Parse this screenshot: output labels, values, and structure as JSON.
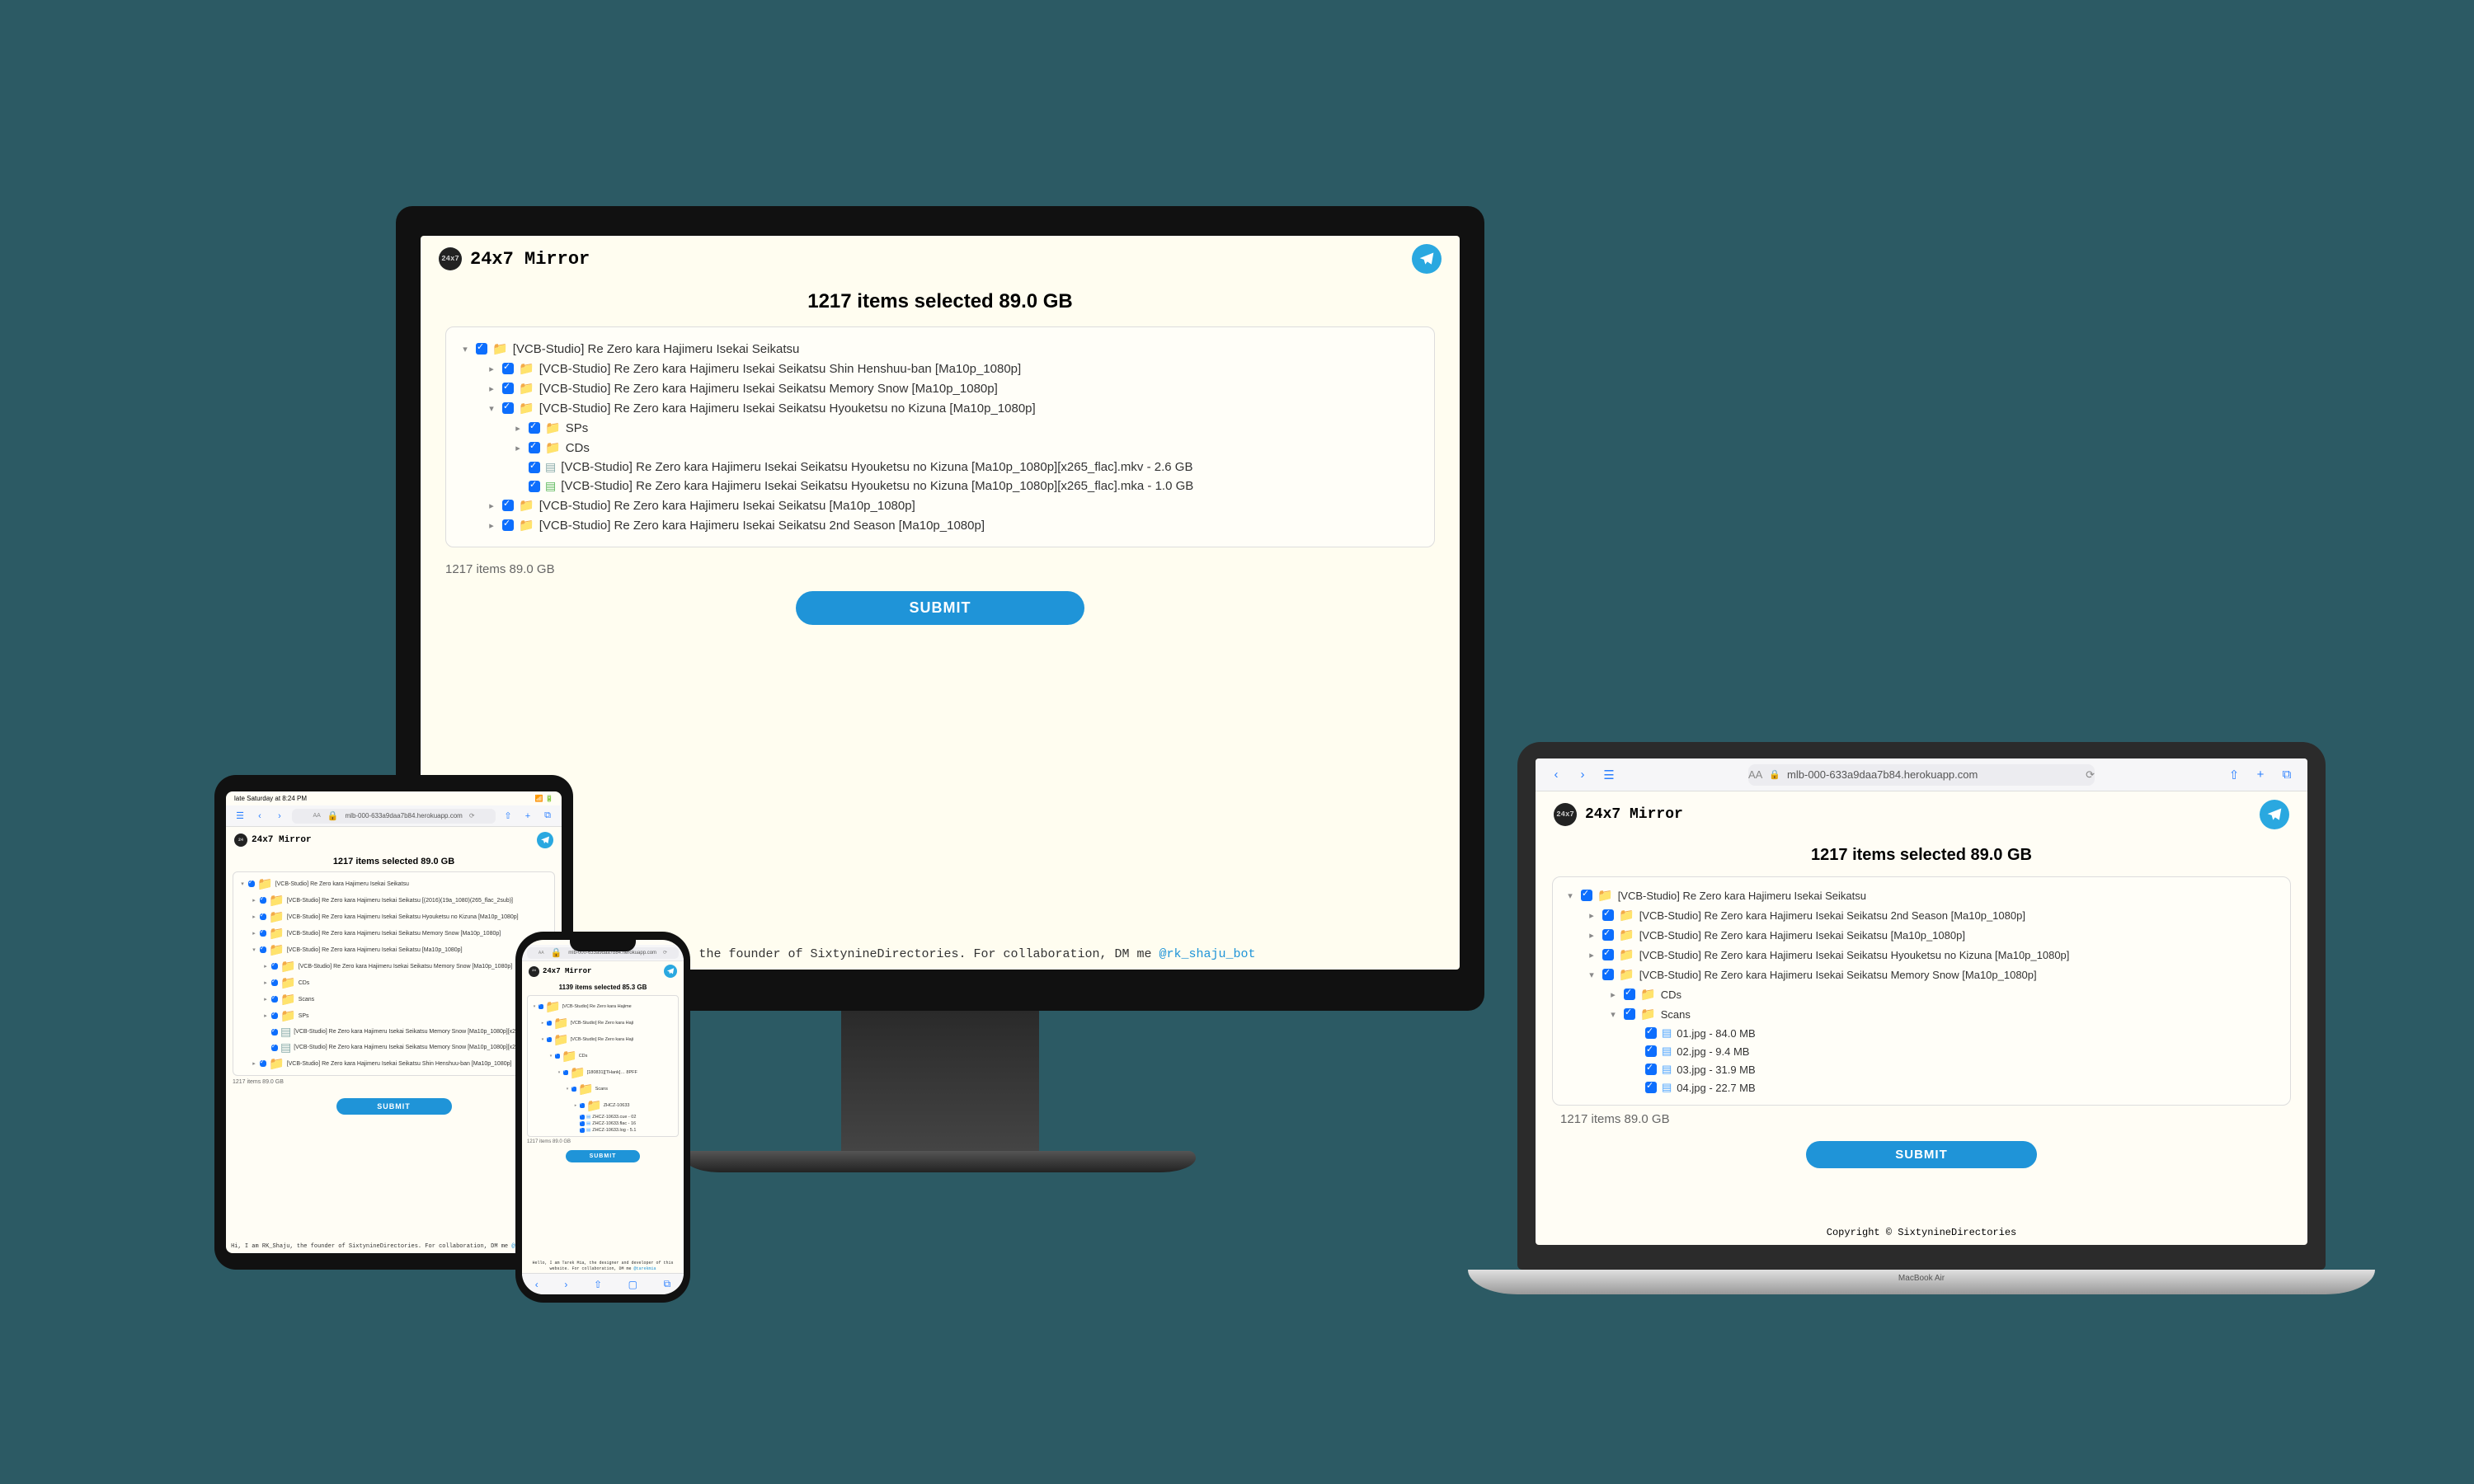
{
  "app_title": "24x7 Mirror",
  "telegram_icon": "telegram",
  "submit_label": "SUBMIT",
  "url_host": "mlb-000-633a9daa7b84.herokuapp.com",
  "laptop_brand": "MacBook Air",
  "copyright": "Copyright © SixtynineDirectories",
  "tablet_status_left": "late Saturday at 8:24 PM",
  "desktop": {
    "items_bar": "1217 items selected 89.0 GB",
    "status_line": "1217 items 89.0 GB",
    "tree": [
      {
        "depth": 0,
        "arrow": "v",
        "type": "folder",
        "label": "[VCB-Studio] Re Zero kara Hajimeru Isekai Seikatsu"
      },
      {
        "depth": 1,
        "arrow": ">",
        "type": "folder",
        "label": "[VCB-Studio] Re Zero kara Hajimeru Isekai Seikatsu Shin Henshuu-ban [Ma10p_1080p]"
      },
      {
        "depth": 1,
        "arrow": ">",
        "type": "folder",
        "label": "[VCB-Studio] Re Zero kara Hajimeru Isekai Seikatsu Memory Snow [Ma10p_1080p]"
      },
      {
        "depth": 1,
        "arrow": "v",
        "type": "folder",
        "label": "[VCB-Studio] Re Zero kara Hajimeru Isekai Seikatsu Hyouketsu no Kizuna [Ma10p_1080p]"
      },
      {
        "depth": 2,
        "arrow": ">",
        "type": "folder",
        "label": "SPs"
      },
      {
        "depth": 2,
        "arrow": ">",
        "type": "folder",
        "label": "CDs"
      },
      {
        "depth": 2,
        "arrow": "",
        "type": "file-grey",
        "label": "[VCB-Studio] Re Zero kara Hajimeru Isekai Seikatsu Hyouketsu no Kizuna [Ma10p_1080p][x265_flac].mkv - 2.6 GB"
      },
      {
        "depth": 2,
        "arrow": "",
        "type": "file-green",
        "label": "[VCB-Studio] Re Zero kara Hajimeru Isekai Seikatsu Hyouketsu no Kizuna [Ma10p_1080p][x265_flac].mka - 1.0 GB"
      },
      {
        "depth": 1,
        "arrow": ">",
        "type": "folder",
        "label": "[VCB-Studio] Re Zero kara Hajimeru Isekai Seikatsu [Ma10p_1080p]"
      },
      {
        "depth": 1,
        "arrow": ">",
        "type": "folder",
        "label": "[VCB-Studio] Re Zero kara Hajimeru Isekai Seikatsu 2nd Season [Ma10p_1080p]"
      }
    ],
    "footer": {
      "pre": "RK_Shaju, the founder of SixtynineDirectories. For collaboration, DM me ",
      "link": "@rk_shaju_bot"
    }
  },
  "laptop": {
    "items_bar": "1217 items selected 89.0 GB",
    "status_line": "1217 items 89.0 GB",
    "tree": [
      {
        "depth": 0,
        "arrow": "v",
        "type": "folder",
        "label": "[VCB-Studio] Re Zero kara Hajimeru Isekai Seikatsu"
      },
      {
        "depth": 1,
        "arrow": ">",
        "type": "folder",
        "label": "[VCB-Studio] Re Zero kara Hajimeru Isekai Seikatsu 2nd Season [Ma10p_1080p]"
      },
      {
        "depth": 1,
        "arrow": ">",
        "type": "folder",
        "label": "[VCB-Studio] Re Zero kara Hajimeru Isekai Seikatsu [Ma10p_1080p]"
      },
      {
        "depth": 1,
        "arrow": ">",
        "type": "folder",
        "label": "[VCB-Studio] Re Zero kara Hajimeru Isekai Seikatsu Hyouketsu no Kizuna [Ma10p_1080p]"
      },
      {
        "depth": 1,
        "arrow": "v",
        "type": "folder",
        "label": "[VCB-Studio] Re Zero kara Hajimeru Isekai Seikatsu Memory Snow [Ma10p_1080p]"
      },
      {
        "depth": 2,
        "arrow": ">",
        "type": "folder",
        "label": "CDs"
      },
      {
        "depth": 2,
        "arrow": "v",
        "type": "folder",
        "label": "Scans"
      },
      {
        "depth": 3,
        "arrow": "",
        "type": "file-blue",
        "label": "01.jpg - 84.0 MB"
      },
      {
        "depth": 3,
        "arrow": "",
        "type": "file-blue",
        "label": "02.jpg - 9.4 MB"
      },
      {
        "depth": 3,
        "arrow": "",
        "type": "file-blue",
        "label": "03.jpg - 31.9 MB"
      },
      {
        "depth": 3,
        "arrow": "",
        "type": "file-blue",
        "label": "04.jpg - 22.7 MB"
      }
    ]
  },
  "tablet": {
    "items_bar": "1217 items selected 89.0 GB",
    "status_line": "1217 items 89.0 GB",
    "tree": [
      {
        "depth": 0,
        "arrow": "v",
        "type": "folder",
        "label": "[VCB-Studio] Re Zero kara Hajimeru Isekai Seikatsu"
      },
      {
        "depth": 1,
        "arrow": ">",
        "type": "folder",
        "label": "[VCB-Studio] Re Zero kara Hajimeru Isekai Seikatsu [(2016)(19a_1080)(265_flac_2sub)]"
      },
      {
        "depth": 1,
        "arrow": ">",
        "type": "folder",
        "label": "[VCB-Studio] Re Zero kara Hajimeru Isekai Seikatsu Hyouketsu no Kizuna [Ma10p_1080p]"
      },
      {
        "depth": 1,
        "arrow": ">",
        "type": "folder",
        "label": "[VCB-Studio] Re Zero kara Hajimeru Isekai Seikatsu Memory Snow [Ma10p_1080p]"
      },
      {
        "depth": 1,
        "arrow": "v",
        "type": "folder",
        "label": "[VCB-Studio] Re Zero kara Hajimeru Isekai Seikatsu [Ma10p_1080p]"
      },
      {
        "depth": 2,
        "arrow": ">",
        "type": "folder",
        "label": "[VCB-Studio] Re Zero kara Hajimeru Isekai Seikatsu Memory Snow [Ma10p_1080p]"
      },
      {
        "depth": 2,
        "arrow": ">",
        "type": "folder",
        "label": "CDs"
      },
      {
        "depth": 2,
        "arrow": ">",
        "type": "folder",
        "label": "Scans"
      },
      {
        "depth": 2,
        "arrow": ">",
        "type": "folder",
        "label": "SPs"
      },
      {
        "depth": 2,
        "arrow": "",
        "type": "file-grey",
        "label": "[VCB-Studio] Re Zero kara Hajimeru Isekai Seikatsu Memory Snow [Ma10p_1080p][x265]"
      },
      {
        "depth": 2,
        "arrow": "",
        "type": "file-grey",
        "label": "[VCB-Studio] Re Zero kara Hajimeru Isekai Seikatsu Memory Snow [Ma10p_1080p][x265]"
      },
      {
        "depth": 1,
        "arrow": ">",
        "type": "folder",
        "label": "[VCB-Studio] Re Zero kara Hajimeru Isekai Seikatsu Shin Henshuu-ban [Ma10p_1080p]"
      }
    ],
    "footer": {
      "pre": "Hi, I am RK_Shaju, the founder of SixtynineDirectories. For collaboration, DM me ",
      "link": "@rk_shaju_bot"
    }
  },
  "phone": {
    "items_bar": "1139 items selected 85.3 GB",
    "status_line": "1217 items 89.0 GB",
    "tree": [
      {
        "depth": 0,
        "arrow": "v",
        "type": "folder",
        "label": "[VCB-Studio] Re Zero kara Hajime"
      },
      {
        "depth": 1,
        "arrow": ">",
        "type": "folder",
        "label": "[VCB-Studio] Re Zero kara Haji"
      },
      {
        "depth": 1,
        "arrow": "v",
        "type": "folder",
        "label": "[VCB-Studio] Re Zero kara Haji"
      },
      {
        "depth": 2,
        "arrow": "v",
        "type": "folder",
        "label": "CDs"
      },
      {
        "depth": 3,
        "arrow": "v",
        "type": "folder",
        "label": "[180831][THank]… 8PFF"
      },
      {
        "depth": 4,
        "arrow": "v",
        "type": "folder",
        "label": "Scans"
      },
      {
        "depth": 5,
        "arrow": ">",
        "type": "folder",
        "label": "ZHCZ-10633"
      },
      {
        "depth": 5,
        "arrow": "",
        "type": "file-blue",
        "label": "ZHCZ-10633.cue - 02"
      },
      {
        "depth": 5,
        "arrow": "",
        "type": "file-blue",
        "label": "ZHCZ-10633.flac - 16"
      },
      {
        "depth": 5,
        "arrow": "",
        "type": "file-blue",
        "label": "ZHCZ-10633.log - 5.1"
      }
    ],
    "footer": {
      "pre": "Hello, I am Tarek Mia, the designer and developer of this website. For collaboration, DM me ",
      "link": "@tarekmia"
    }
  }
}
